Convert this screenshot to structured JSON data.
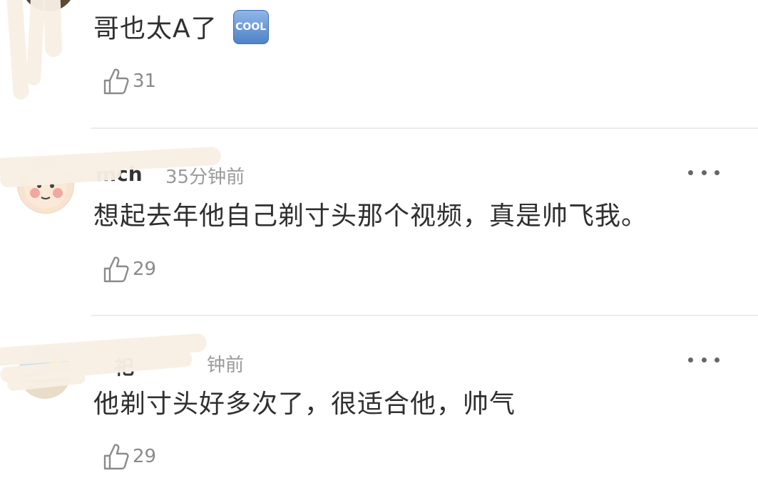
{
  "comments": [
    {
      "username": "",
      "time": "",
      "text": "哥也太A了",
      "badge": "COOL",
      "likes": "31",
      "avatar_icon": "avatar-partial"
    },
    {
      "username": "mch",
      "time": "35分钟前",
      "text": "想起去年他自己剃寸头那个视频，真是帅飞我。",
      "likes": "29",
      "avatar_icon": "cartoon-face-avatar"
    },
    {
      "username": "祀",
      "time": "钟前",
      "text": "他剃寸头好多次了，很适合他，帅气",
      "likes": "29",
      "avatar_icon": "landscape-avatar"
    }
  ],
  "icons": {
    "like": "thumbs-up-outline-icon",
    "more": "more-dots-icon"
  },
  "colors": {
    "text": "#2f2f2f",
    "meta": "#9a9a9a",
    "like": "#8a8a8a",
    "divider": "#ececec",
    "scribble": "#f8efe4"
  }
}
